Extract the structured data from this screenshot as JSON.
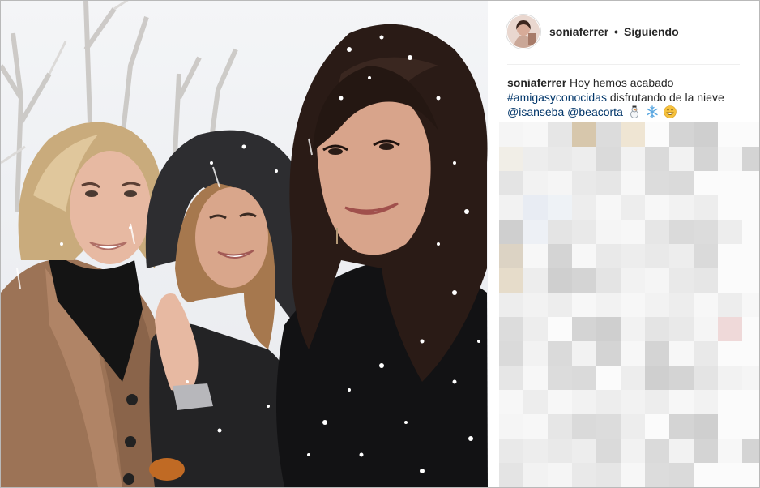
{
  "post": {
    "username": "soniaferrer",
    "separator": "•",
    "follow_status": "Siguiendo",
    "caption": {
      "user": "soniaferrer",
      "text_1": "Hoy hemos acabado",
      "hashtag": "#amigasyconocidas",
      "text_2": "disfrutando de la nieve",
      "mention_1": "@isanseba",
      "mention_2": "@beacorta"
    },
    "emojis": [
      "snowman-icon",
      "snowflake-icon",
      "smiling-face-icon"
    ]
  },
  "colors": {
    "link": "#003569",
    "text": "#262626",
    "divider": "#efefef",
    "border": "#b9b9b9"
  }
}
